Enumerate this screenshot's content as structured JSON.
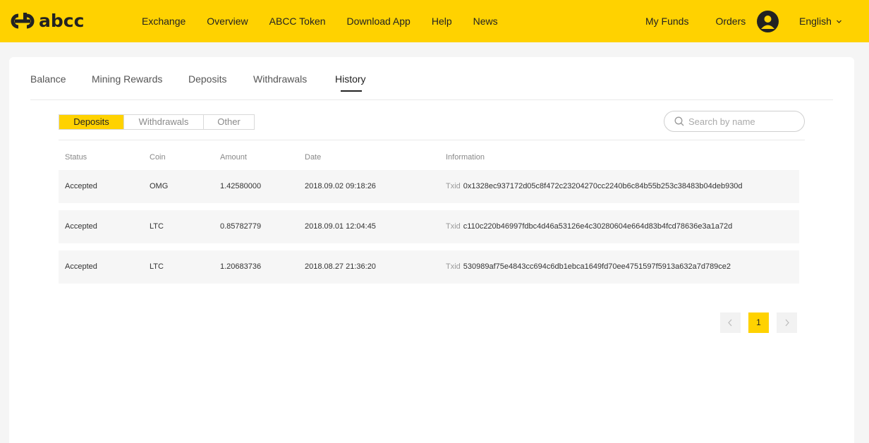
{
  "brand": {
    "logo_text": "abcc"
  },
  "nav": {
    "left": [
      "Exchange",
      "Overview",
      "ABCC Token",
      "Download App",
      "Help",
      "News"
    ],
    "right": [
      "My Funds",
      "Orders"
    ],
    "language": "English"
  },
  "tabs": [
    "Balance",
    "Mining Rewards",
    "Deposits",
    "Withdrawals",
    "History"
  ],
  "active_tab": "History",
  "filter": {
    "options": [
      "Deposits",
      "Withdrawals",
      "Other"
    ],
    "active": "Deposits"
  },
  "search": {
    "placeholder": "Search by name"
  },
  "table": {
    "columns": [
      "Status",
      "Coin",
      "Amount",
      "Date",
      "Information"
    ],
    "txid_label": "Txid",
    "rows": [
      {
        "status": "Accepted",
        "coin": "OMG",
        "amount": "1.42580000",
        "date": "2018.09.02 09:18:26",
        "txid": "0x1328ec937172d05c8f472c23204270cc2240b6c84b55b253c38483b04deb930d"
      },
      {
        "status": "Accepted",
        "coin": "LTC",
        "amount": "0.85782779",
        "date": "2018.09.01 12:04:45",
        "txid": "c110c220b46997fdbc4d46a53126e4c30280604e664d83b4fcd78636e3a1a72d"
      },
      {
        "status": "Accepted",
        "coin": "LTC",
        "amount": "1.20683736",
        "date": "2018.08.27 21:36:20",
        "txid": "530989af75e4843cc694c6db1ebca1649fd70ee4751597f5913a632a7d789ce2"
      }
    ]
  },
  "pagination": {
    "current_page": "1",
    "prev_icon": "chevron-left-icon",
    "next_icon": "chevron-right-icon"
  },
  "colors": {
    "accent": "#ffd200",
    "dark": "#222222"
  }
}
